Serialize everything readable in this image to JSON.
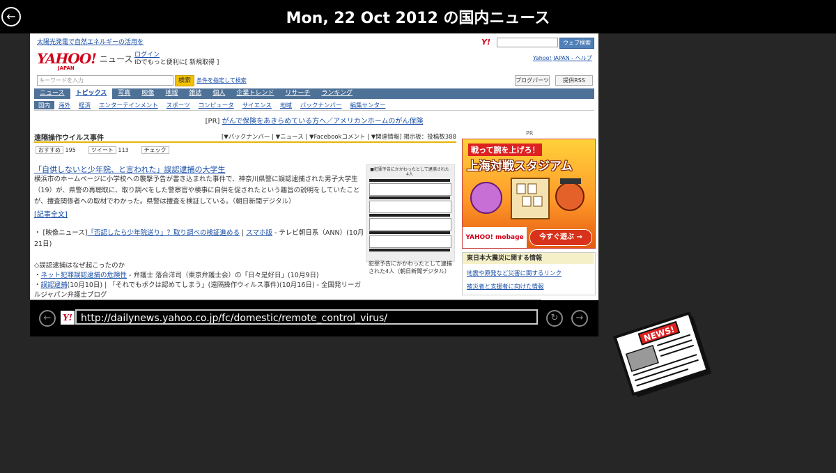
{
  "app": {
    "title": "Mon, 22 Oct 2012 の国内ニュース"
  },
  "browser": {
    "url": "http://dailynews.yahoo.co.jp/fc/domestic/remote_control_virus/"
  },
  "page": {
    "top_line": "太陽光発電で自然エネルギーの活用を",
    "logo_text": "YAHOO!",
    "logo_sub": "JAPAN",
    "section_label": "ニュース",
    "login_link": "ログイン",
    "login_note": "IDでもっと便利に[ 新規取得 ]",
    "search_button": "ウェブ検索",
    "top_links": "Yahoo! JAPAN - ヘルプ",
    "keyword_placeholder": "キーワードを入力",
    "keyword_search_btn": "検索",
    "advanced_search": "条件を指定して検索",
    "blog_parts": "ブログパーツ",
    "rss": "提供RSS",
    "nav_items": [
      "ニュース",
      "トピックス",
      "写真",
      "映像",
      "地域",
      "雑誌",
      "個人",
      "企業トレンド",
      "リサーチ",
      "ランキング"
    ],
    "subnav_items": [
      "国内",
      "海外",
      "経済",
      "エンターテインメント",
      "スポーツ",
      "コンピュータ",
      "サイエンス",
      "地域",
      "バックナンバー",
      "編集センター"
    ],
    "pr_tag": "[PR]",
    "pr_text": "がんで保険をあきらめている方へ／アメリカンホームのがん保険",
    "category": "遠隔操作ウイルス事件",
    "article_links": "[▼バックナンバー | ▼ニュース | ▼Facebookコメント | ▼関連情報] 掲示板：投稿数388",
    "share": {
      "fb_label": "おすすめ",
      "fb_count": "195",
      "tw_label": "ツイート",
      "tw_count": "113",
      "check_label": "チェック"
    },
    "article_title": "「自供しないと少年院、と言われた」誤認逮捕の大学生",
    "article_body": "横浜市のホームページに小学校への襲撃予告が書き込まれた事件で、神奈川県警に誤認逮捕された男子大学生（19）が、県警の再聴取に、取り調べをした警察官や検事に自供を促されたという趣旨の説明をしていたことが、捜査関係者への取材でわかった。県警は捜査を検証している。（朝日新聞デジタル）",
    "article_more": "[記事全文]",
    "video_line_prefix": "・ [映像ニュース]",
    "video_link": "「否認したら少年院送り」？取り調べの検証進める",
    "video_sep": " | ",
    "video_link2": "スマホ版",
    "video_suffix": " - テレビ朝日系（ANN）(10月21日)",
    "why_head": "◇誤認逮捕はなぜ起こったのか",
    "why_items": [
      {
        "link": "ネット犯罪誤認逮捕の危険性",
        "rest": " - 弁護士 落合洋司（東京弁護士会）の「日々是好日」(10月9日)"
      },
      {
        "link": "誤認逮捕",
        "rest": "(10月10日) | 「それでもボクは認めてしまう」(遠隔操作ウィルス事件)(10月16日) - 全国発リーガルジャパン弁護士ブログ"
      }
    ],
    "thumb_header": "■犯罪予告にかかわったとして逮捕された4人",
    "thumb_caption": "犯罪予告にかかわったとして逮捕された4人（朝日新聞デジタル）",
    "pr_label": "PR",
    "ad_tagline": "戦って腕を上げろ！",
    "ad_title": "上海対戦スタジアム",
    "ad_brand": "YAHOO! mobage",
    "ad_cta": "今すぐ遊ぶ →",
    "quake_title": "東日本大震災に関する情報",
    "quake_links": [
      "地震や原発など災害に関するリンク",
      "被災者と支援者に向けた情報"
    ]
  },
  "icons": {
    "back": "back-arrow-icon",
    "nav_back": "left-arrow-icon",
    "refresh": "refresh-icon",
    "nav_forward": "right-arrow-icon",
    "newspaper": "newspaper-icon"
  },
  "colors": {
    "topbar": "#000000",
    "background": "#262626",
    "yahoo_red": "#d0021b",
    "nav_blue": "#4e7197"
  }
}
